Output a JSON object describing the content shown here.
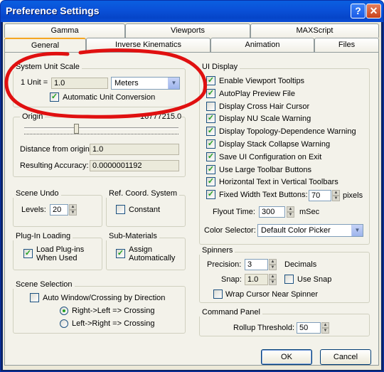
{
  "window": {
    "title": "Preference Settings",
    "help_glyph": "?",
    "close_glyph": "✕"
  },
  "tabs_top": [
    "Gamma",
    "Viewports",
    "MAXScript"
  ],
  "tabs_bottom": [
    "General",
    "Inverse Kinematics",
    "Animation",
    "Files"
  ],
  "system_unit_scale": {
    "label": "System Unit Scale",
    "unit_label": "1 Unit =",
    "unit_value": "1.0",
    "units": "Meters",
    "auto_convert": "Automatic Unit Conversion"
  },
  "origin": {
    "label": "Origin",
    "value": "16777215.0",
    "distance_label": "Distance from origin:",
    "distance_value": "1.0",
    "accuracy_label": "Resulting Accuracy:",
    "accuracy_value": "0.0000001192"
  },
  "scene_undo": {
    "label": "Scene Undo",
    "levels_label": "Levels:",
    "levels_value": "20"
  },
  "ref_coord": {
    "label": "Ref. Coord. System",
    "constant": "Constant"
  },
  "plugin_loading": {
    "label": "Plug-In Loading",
    "load_line1": "Load Plug-ins",
    "load_line2": "When Used"
  },
  "sub_materials": {
    "label": "Sub-Materials",
    "assign_line1": "Assign",
    "assign_line2": "Automatically"
  },
  "scene_selection": {
    "label": "Scene Selection",
    "auto_window": "Auto Window/Crossing by Direction",
    "rl": "Right->Left => Crossing",
    "lr": "Left->Right => Crossing"
  },
  "ui_display": {
    "label": "UI Display",
    "items": [
      {
        "label": "Enable Viewport Tooltips",
        "checked": true
      },
      {
        "label": "AutoPlay Preview File",
        "checked": true
      },
      {
        "label": "Display Cross Hair Cursor",
        "checked": false
      },
      {
        "label": "Display NU Scale Warning",
        "checked": true
      },
      {
        "label": "Display Topology-Dependence Warning",
        "checked": true
      },
      {
        "label": "Display Stack Collapse Warning",
        "checked": true
      },
      {
        "label": "Save UI Configuration on Exit",
        "checked": true
      },
      {
        "label": "Use Large Toolbar Buttons",
        "checked": true
      },
      {
        "label": "Horizontal Text in Vertical Toolbars",
        "checked": true
      },
      {
        "label": "Fixed Width Text Buttons:",
        "checked": true
      }
    ],
    "fixed_width_value": "70",
    "pixels": "pixels",
    "flyout_label": "Flyout Time:",
    "flyout_value": "300",
    "msec": "mSec",
    "color_selector_label": "Color Selector:",
    "color_selector_value": "Default Color Picker"
  },
  "spinners": {
    "label": "Spinners",
    "precision_label": "Precision:",
    "precision_value": "3",
    "decimals": "Decimals",
    "snap_label": "Snap:",
    "snap_value": "1.0",
    "use_snap": "Use Snap",
    "wrap": "Wrap Cursor Near Spinner"
  },
  "command_panel": {
    "label": "Command Panel",
    "rollup_label": "Rollup Threshold:",
    "rollup_value": "50"
  },
  "buttons": {
    "ok": "OK",
    "cancel": "Cancel"
  },
  "colors": {
    "titlebar": "#0a50d8",
    "annotation": "#e01010"
  }
}
